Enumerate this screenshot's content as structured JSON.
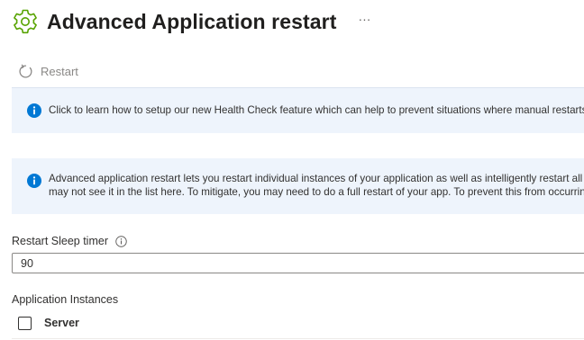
{
  "header": {
    "title": "Advanced Application restart",
    "more_label": "···",
    "icon": "gear-icon"
  },
  "toolbar": {
    "restart_label": "Restart",
    "restart_icon": "restart-icon"
  },
  "info_banner_1": {
    "text": "Click to learn how to setup our new Health Check feature which can help to prevent situations where manual restarts are needed."
  },
  "info_banner_2": {
    "line1": "Advanced application restart lets you restart individual instances of your application as well as intelligently restart all instances.",
    "line2": "may not see it in the list here.  To mitigate, you may need to do a full restart of your app.  To prevent this from occurring again,"
  },
  "sleep_timer": {
    "label": "Restart Sleep timer",
    "value": "90"
  },
  "instances": {
    "label": "Application Instances",
    "columns": [
      "Server"
    ]
  },
  "colors": {
    "accent": "#0078d4",
    "gear": "#57a300",
    "banner_bg": "#eef4fc"
  }
}
